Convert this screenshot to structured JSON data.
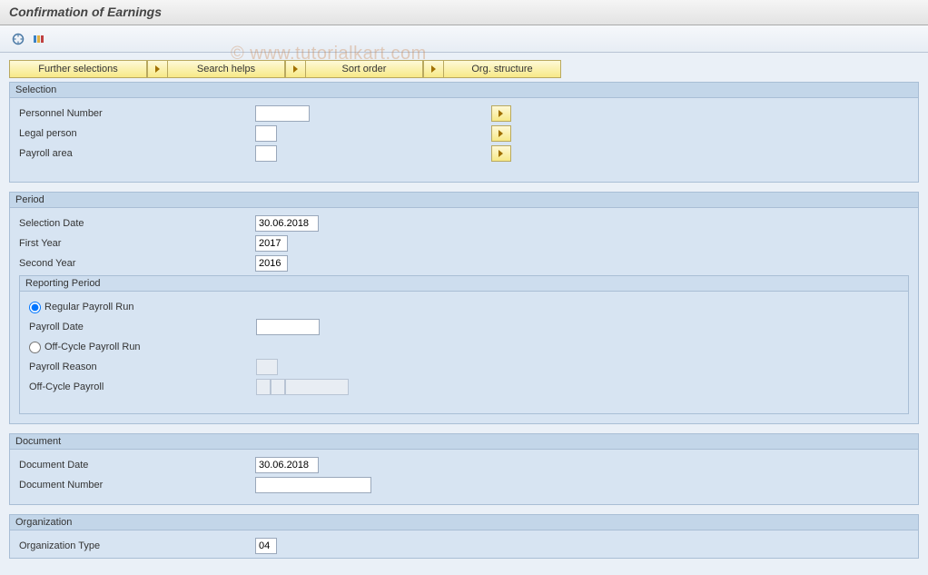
{
  "title": "Confirmation of Earnings",
  "watermark": "© www.tutorialkart.com",
  "toolbar_buttons": {
    "further": "Further selections",
    "search": "Search helps",
    "sort": "Sort order",
    "org": "Org. structure"
  },
  "selection": {
    "title": "Selection",
    "personnel_number": {
      "label": "Personnel Number",
      "value": ""
    },
    "legal_person": {
      "label": "Legal person",
      "value": ""
    },
    "payroll_area": {
      "label": "Payroll area",
      "value": ""
    }
  },
  "period": {
    "title": "Period",
    "selection_date": {
      "label": "Selection Date",
      "value": "30.06.2018"
    },
    "first_year": {
      "label": "First Year",
      "value": "2017"
    },
    "second_year": {
      "label": "Second Year",
      "value": "2016"
    },
    "reporting": {
      "title": "Reporting Period",
      "regular": "Regular Payroll Run",
      "payroll_date": {
        "label": "Payroll Date",
        "value": ""
      },
      "offcycle": "Off-Cycle Payroll Run",
      "payroll_reason": {
        "label": "Payroll Reason",
        "value": ""
      },
      "offcycle_payroll": {
        "label": "Off-Cycle Payroll",
        "v1": "",
        "v2": "",
        "v3": ""
      }
    }
  },
  "document": {
    "title": "Document",
    "date": {
      "label": "Document Date",
      "value": "30.06.2018"
    },
    "number": {
      "label": "Document Number",
      "value": ""
    }
  },
  "organization": {
    "title": "Organization",
    "type": {
      "label": "Organization Type",
      "value": "04"
    }
  }
}
